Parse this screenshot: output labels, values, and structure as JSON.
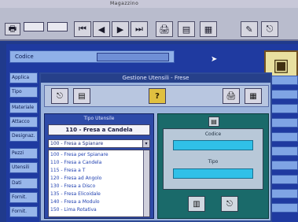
{
  "window": {
    "title": "Magazzino"
  },
  "toolbar": {
    "fields": [
      "",
      ""
    ],
    "buttons": [
      {
        "name": "print-icon",
        "glyph": "🖶"
      },
      {
        "name": "first-icon",
        "glyph": "⏮"
      },
      {
        "name": "prev-icon",
        "glyph": "◀"
      },
      {
        "name": "next-icon",
        "glyph": "▶"
      },
      {
        "name": "last-icon",
        "glyph": "⏭"
      },
      {
        "name": "printer-icon",
        "glyph": "🖨"
      },
      {
        "name": "form-icon",
        "glyph": "▤"
      },
      {
        "name": "tools-icon",
        "glyph": "✎"
      },
      {
        "name": "exit-icon",
        "glyph": "⎋"
      }
    ]
  },
  "code_row": {
    "label": "Codice",
    "value": ""
  },
  "left_menu": [
    "Applica",
    "Tipo",
    "Materiale",
    "Attacco",
    "Designaz.",
    "Pezzi",
    "Utensili",
    "Dati",
    "Fornit.",
    "Fornit."
  ],
  "dialog": {
    "title": "Gestione Utensili - Frese",
    "toolbar": {
      "help_label": "?"
    },
    "left_panel": {
      "title": "Tipo Utensile",
      "selected": "110 - Fresa a Candela",
      "combo_value": "100 - Fresa a Spianare",
      "list": [
        "100 - Fresa per Spianare",
        "110 - Fresa a Candela",
        "115 - Fresa a T",
        "120 - Fresa ad Angolo",
        "130 - Fresa a Disco",
        "135 - Fresa Elicoidale",
        "140 - Fresa a Modulo",
        "150 - Lima Rotativa"
      ]
    },
    "right_panel": {
      "code_label": "Codice",
      "type_label": "Tipo"
    }
  },
  "colors": {
    "accent": "#26408a",
    "panel": "#9cb4dc",
    "field": "#30c0e8"
  }
}
